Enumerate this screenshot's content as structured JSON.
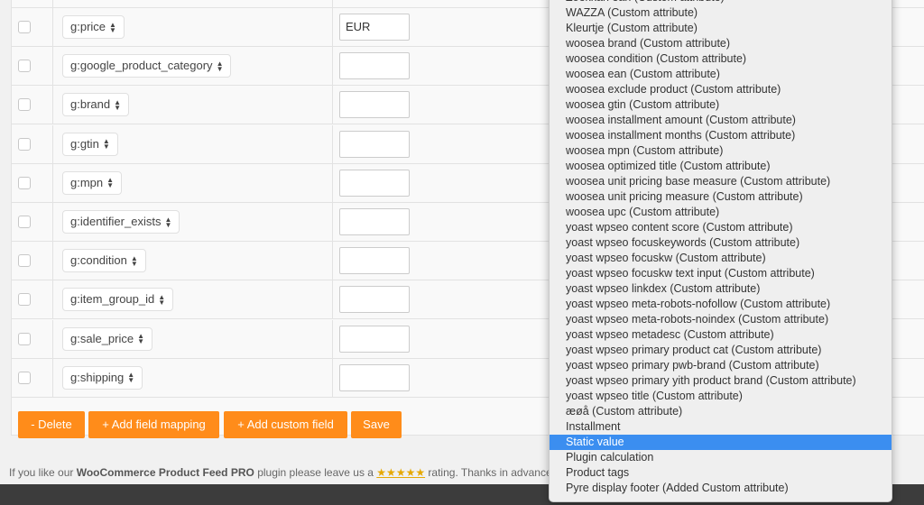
{
  "rows": [
    {
      "field": "g:price",
      "value": "EUR"
    },
    {
      "field": "g:google_product_category",
      "value": ""
    },
    {
      "field": "g:brand",
      "value": ""
    },
    {
      "field": "g:gtin",
      "value": ""
    },
    {
      "field": "g:mpn",
      "value": ""
    },
    {
      "field": "g:identifier_exists",
      "value": ""
    },
    {
      "field": "g:condition",
      "value": ""
    },
    {
      "field": "g:item_group_id",
      "value": ""
    },
    {
      "field": "g:sale_price",
      "value": ""
    },
    {
      "field": "g:shipping",
      "value": ""
    }
  ],
  "buttons": {
    "delete": "- Delete",
    "add_mapping": "+ Add field mapping",
    "add_custom": "+ Add custom field",
    "save": "Save"
  },
  "footer": {
    "pre": "If you like our ",
    "plugin": "WooCommerce Product Feed PRO",
    "mid": " plugin please leave us a ",
    "stars": "★★★★★",
    "post": " rating. Thanks in advance"
  },
  "dropdown": {
    "selected": "Static value",
    "highlight_color": "#3b8ef0",
    "options": [
      "Zoekkan ean (Custom attribute)",
      "WAZZA (Custom attribute)",
      "Kleurtje (Custom attribute)",
      "woosea brand (Custom attribute)",
      "woosea condition (Custom attribute)",
      "woosea ean (Custom attribute)",
      "woosea exclude product (Custom attribute)",
      "woosea gtin (Custom attribute)",
      "woosea installment amount (Custom attribute)",
      "woosea installment months (Custom attribute)",
      "woosea mpn (Custom attribute)",
      "woosea optimized title (Custom attribute)",
      "woosea unit pricing base measure (Custom attribute)",
      "woosea unit pricing measure (Custom attribute)",
      "woosea upc (Custom attribute)",
      "yoast wpseo content score (Custom attribute)",
      "yoast wpseo focuskeywords (Custom attribute)",
      "yoast wpseo focuskw (Custom attribute)",
      "yoast wpseo focuskw text input (Custom attribute)",
      "yoast wpseo linkdex (Custom attribute)",
      "yoast wpseo meta-robots-nofollow (Custom attribute)",
      "yoast wpseo meta-robots-noindex (Custom attribute)",
      "yoast wpseo metadesc (Custom attribute)",
      "yoast wpseo primary product cat (Custom attribute)",
      "yoast wpseo primary pwb-brand (Custom attribute)",
      "yoast wpseo primary yith product brand (Custom attribute)",
      "yoast wpseo title (Custom attribute)",
      "æøå (Custom attribute)",
      "Installment",
      "Static value",
      "Plugin calculation",
      "Product tags",
      "Pyre display footer (Added Custom attribute)"
    ]
  },
  "accent_color": "#ff8c1a"
}
